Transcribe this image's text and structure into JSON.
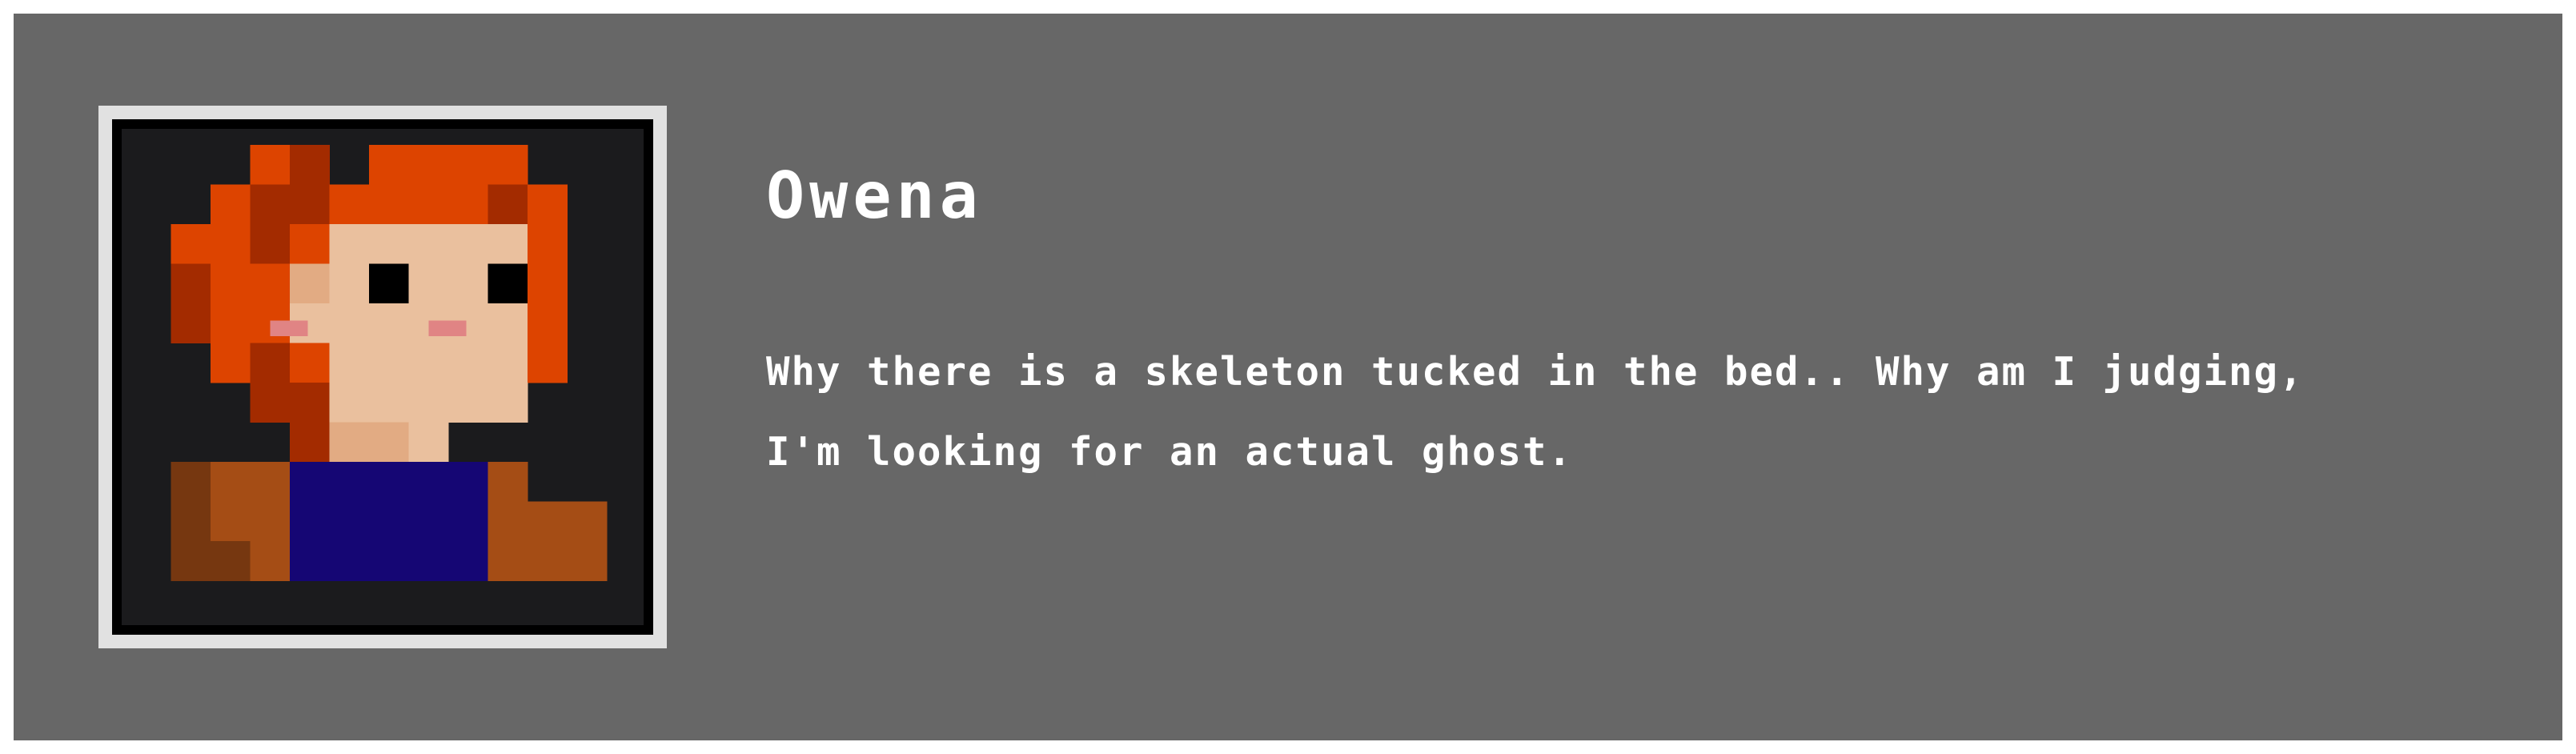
{
  "dialog": {
    "speaker": "Owena",
    "text": "Why there is a skeleton tucked in the bed.. Why am I judging, I'm looking for an actual ghost."
  },
  "portrait": {
    "icon": "red-haired-girl-pixel-portrait",
    "colors": {
      "hair": "#dd4400",
      "hair_shadow": "#a32b00",
      "skin": "#eac09e",
      "skin_shadow": "#e2ab83",
      "eyes": "#000000",
      "blush": "#e08484",
      "shirt": "#150674",
      "jacket": "#a54d15",
      "jacket_shadow": "#763710",
      "background": "#1b1b1d"
    }
  },
  "theme": {
    "panel": "#676767",
    "frame": "#e1e1e1",
    "text": "#ffffff"
  }
}
